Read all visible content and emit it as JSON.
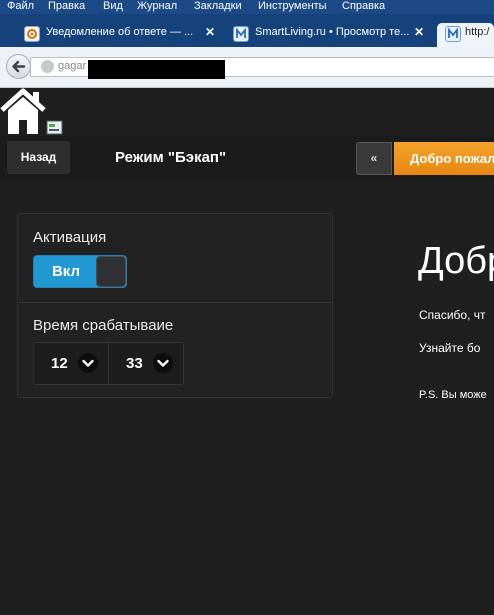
{
  "browser": {
    "menu": [
      "Файл",
      "Правка",
      "Вид",
      "Журнал",
      "Закладки",
      "Инструменты",
      "Справка"
    ],
    "tabs": [
      {
        "title": "Уведомление об ответе — ...",
        "close": "✕",
        "icon": "at-icon"
      },
      {
        "title": "SmartLiving.ru • Просмотр те...",
        "close": "✕",
        "icon": "m-logo-icon"
      },
      {
        "title": "http:/",
        "icon": "m-logo-icon"
      }
    ],
    "url": "gagar"
  },
  "app": {
    "back_label": "Назад",
    "title": "Режим \"Бэкап\"",
    "collapse_label": "«",
    "welcome_tab_label": "Добро пожал"
  },
  "panel": {
    "activation_label": "Активация",
    "toggle_label": "Вкл",
    "toggle_state": "on",
    "trigger_time_label": "Время срабатываие",
    "hour": "12",
    "minute": "33"
  },
  "content": {
    "heading": "Добр",
    "line1": "Спасибо, чт",
    "line2": "Узнайте бо",
    "ps": "P.S. Вы може"
  },
  "colors": {
    "accent_blue": "#2298d2",
    "orange_tab": "#f39a23",
    "background": "#1f1f1f",
    "browser_tabbar": "#16427c"
  }
}
